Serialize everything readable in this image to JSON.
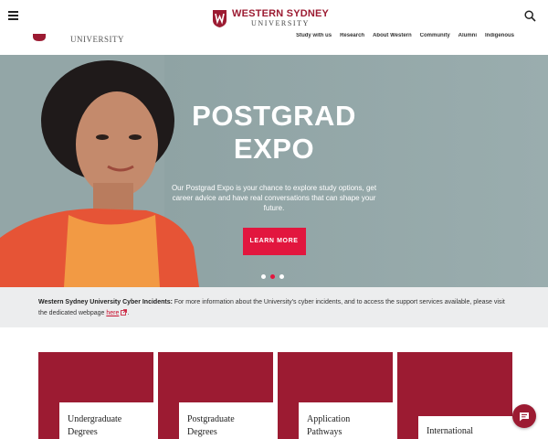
{
  "header": {
    "logo_line1": "WESTERN SYDNEY",
    "logo_line2": "UNIVERSITY",
    "menu_icon": "hamburger-icon",
    "search_icon": "search-icon"
  },
  "subnav": {
    "logo_word": "UNIVERSITY",
    "items": [
      "Study with us",
      "Research",
      "About Western",
      "Community",
      "Alumni",
      "Indigenous"
    ]
  },
  "hero": {
    "title_line1": "POSTGRAD",
    "title_line2": "EXPO",
    "body": "Our Postgrad Expo is your chance to explore study options, get career advice and have real conversations that can shape your future.",
    "button": "LEARN MORE",
    "slide_count": 3,
    "active_slide": 2
  },
  "notice": {
    "heading": "Western Sydney University Cyber Incidents:",
    "text": " For more information about the University's cyber incidents, and to access the support services available, please visit the dedicated webpage ",
    "link": "here",
    "link_icon": "external-link-icon",
    "tail": "."
  },
  "cards": [
    {
      "line1": "Undergraduate",
      "line2": "Degrees"
    },
    {
      "line1": "Postgraduate",
      "line2": "Degrees"
    },
    {
      "line1": "Application",
      "line2": "Pathways"
    },
    {
      "line1": "International",
      "line2": ""
    }
  ],
  "chat": {
    "icon": "chat-icon"
  },
  "colors": {
    "brand": "#9c1b32",
    "accent": "#e2163e",
    "hero_bg": "#93a6a7",
    "notice_bg": "#ecedee"
  }
}
